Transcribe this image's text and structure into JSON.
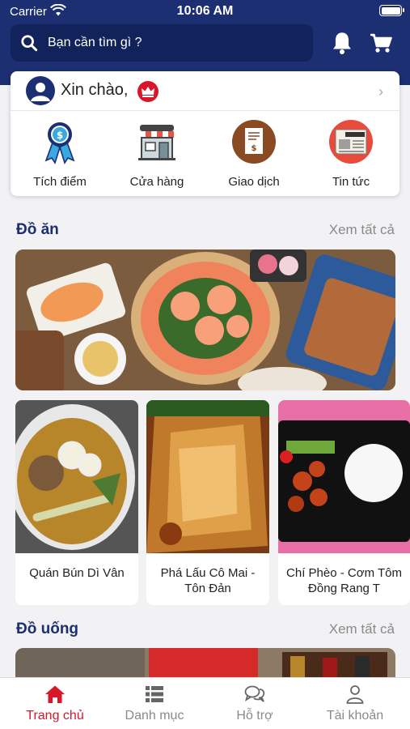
{
  "status_bar": {
    "carrier": "Carrier",
    "time": "10:06 AM"
  },
  "search": {
    "placeholder": "Bạn cần tìm gì ?"
  },
  "greeting": {
    "text": "Xin chào,"
  },
  "quick_actions": [
    {
      "label": "Tích điểm",
      "icon": "ribbon-badge-icon"
    },
    {
      "label": "Cửa hàng",
      "icon": "store-icon"
    },
    {
      "label": "Giao dịch",
      "icon": "receipt-icon"
    },
    {
      "label": "Tin tức",
      "icon": "news-icon"
    }
  ],
  "food_section": {
    "title": "Đồ ăn",
    "see_all": "Xem tất cả"
  },
  "food_items": [
    {
      "name": "Quán Bún Dì Vân"
    },
    {
      "name": "Phá Lấu Cô Mai - Tôn Đản"
    },
    {
      "name": "Chí Phèo - Cơm Tôm Đồng Rang T"
    }
  ],
  "drink_section": {
    "title": "Đồ uống",
    "see_all": "Xem tất cả"
  },
  "tabs": [
    {
      "label": "Trang chủ",
      "icon": "home-icon",
      "active": true
    },
    {
      "label": "Danh mục",
      "icon": "list-icon",
      "active": false
    },
    {
      "label": "Hỗ trợ",
      "icon": "chat-icon",
      "active": false
    },
    {
      "label": "Tài khoản",
      "icon": "user-icon",
      "active": false
    }
  ],
  "colors": {
    "primary": "#1c2f72",
    "accent": "#d8172a",
    "background": "#f2f2f4"
  }
}
